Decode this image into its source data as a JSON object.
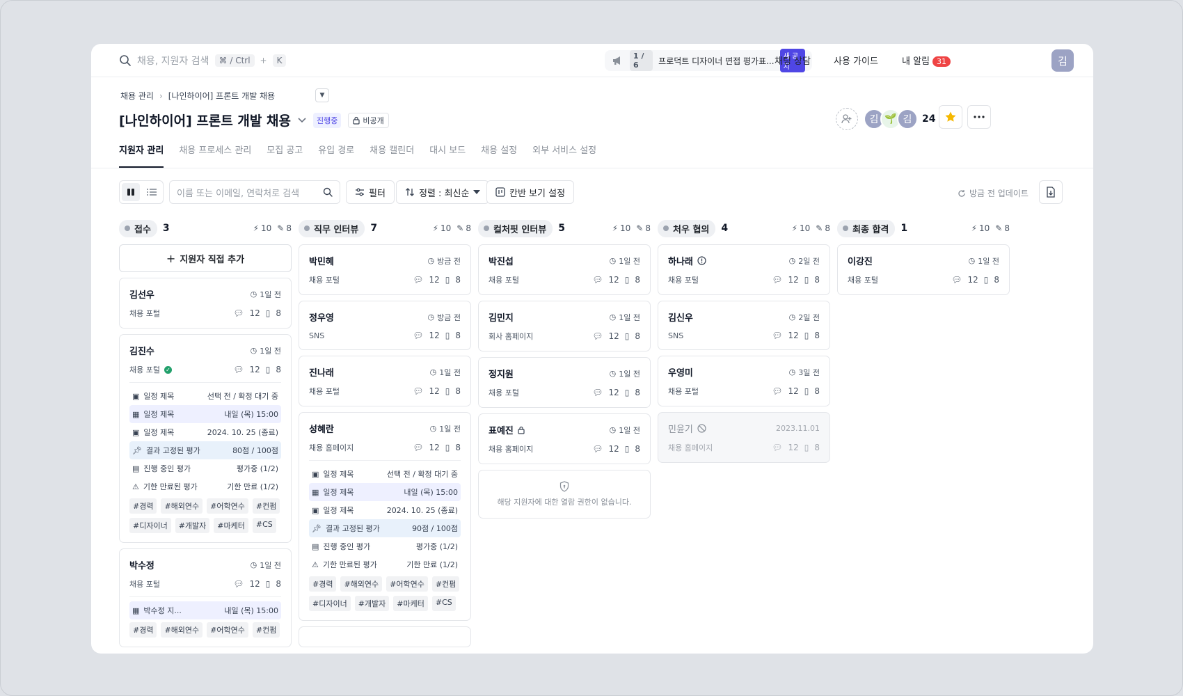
{
  "topbar": {
    "search_placeholder": "채용, 지원자 검색",
    "shortcut_key1": "⌘ / Ctrl",
    "shortcut_plus": "+",
    "shortcut_key2": "K",
    "notice_count": "1 / 6",
    "notice_text": "프로덕트 디자이너 면접 평가표...",
    "notice_badge": "새 공지",
    "links": [
      "채팅 상담",
      "사용 가이드"
    ],
    "alerts_label": "내 알림",
    "alerts_count": "31",
    "user_initial": "김"
  },
  "header": {
    "breadcrumb_root": "채용 관리",
    "breadcrumb_current": "[나인하이어] 프론트 개발 채용",
    "title": "[나인하이어] 프론트 개발 채용",
    "status": "진행중",
    "visibility": "비공개",
    "members": [
      "김",
      "🌱",
      "김"
    ],
    "member_count": "24"
  },
  "tabs": [
    "지원자 관리",
    "채용 프로세스 관리",
    "모집 공고",
    "유입 경로",
    "채용 캘린더",
    "대시 보드",
    "채용 설정",
    "외부 서비스 설정"
  ],
  "toolbar": {
    "search_placeholder": "이름 또는 이메일, 연락처로 검색",
    "filter_label": "필터",
    "sort_label": "정렬 : 최신순",
    "kanban_settings_label": "칸반 보기 설정",
    "refresh_label": "방금 전 업데이트"
  },
  "columns": [
    {
      "name": "접수",
      "count": "3",
      "m1": "10",
      "m2": "8",
      "add_label": "지원자 직접 추가",
      "cards": [
        {
          "name": "김선우",
          "time": "1일 전",
          "source": "채용 포털",
          "s1": "12",
          "s2": "8"
        },
        {
          "name": "김진수",
          "time": "1일 전",
          "source": "채용 포털",
          "s1": "12",
          "s2": "8",
          "details": [
            {
              "label": "일정 제목",
              "value": "선택 전 / 확정 대기 중"
            },
            {
              "label": "일정 제목",
              "value": "내일 (목) 15:00"
            },
            {
              "label": "일정 제목",
              "value": "2024. 10. 25 (종료)"
            },
            {
              "label": "결과 고정된 평가",
              "value": "80점 / 100점"
            },
            {
              "label": "진행 중인 평가",
              "value": "평가중 (1/2)"
            },
            {
              "label": "기한 만료된 평가",
              "value": "기한 만료 (1/2)"
            }
          ],
          "tags": [
            "#경력",
            "#해외연수",
            "#어학연수",
            "#컨펌",
            "#디자이너",
            "#개발자",
            "#마케터",
            "#CS"
          ]
        },
        {
          "name": "박수정",
          "time": "1일 전",
          "source": "채용 포털",
          "s1": "12",
          "s2": "8",
          "details": [
            {
              "label": "박수정 지...",
              "value": "내일 (목) 15:00"
            }
          ],
          "tags": [
            "#경력",
            "#해외연수",
            "#어학연수",
            "#컨펌"
          ]
        }
      ]
    },
    {
      "name": "직무 인터뷰",
      "count": "7",
      "m1": "10",
      "m2": "8",
      "cards": [
        {
          "name": "박민혜",
          "time": "방금 전",
          "source": "채용 포털",
          "s1": "12",
          "s2": "8"
        },
        {
          "name": "정우영",
          "time": "방금 전",
          "source": "SNS",
          "s1": "12",
          "s2": "8"
        },
        {
          "name": "진나래",
          "time": "1일 전",
          "source": "채용 포털",
          "s1": "12",
          "s2": "8"
        },
        {
          "name": "성혜란",
          "time": "1일 전",
          "source": "채용 홈페이지",
          "s1": "12",
          "s2": "8",
          "details": [
            {
              "label": "일정 제목",
              "value": "선택 전 / 확정 대기 중"
            },
            {
              "label": "일정 제목",
              "value": "내일 (목) 15:00"
            },
            {
              "label": "일정 제목",
              "value": "2024. 10. 25 (종료)"
            },
            {
              "label": "결과 고정된 평가",
              "value": "90점 / 100점"
            },
            {
              "label": "진행 중인 평가",
              "value": "평가중 (1/2)"
            },
            {
              "label": "기한 만료된 평가",
              "value": "기한 만료 (1/2)"
            }
          ],
          "tags": [
            "#경력",
            "#해외연수",
            "#어학연수",
            "#컨펌",
            "#디자이너",
            "#개발자",
            "#마케터",
            "#CS"
          ]
        }
      ]
    },
    {
      "name": "컬처핏 인터뷰",
      "count": "5",
      "m1": "10",
      "m2": "8",
      "cards": [
        {
          "name": "박진섭",
          "time": "1일 전",
          "source": "채용 포털",
          "s1": "12",
          "s2": "8"
        },
        {
          "name": "김민지",
          "time": "1일 전",
          "source": "회사 홈페이지",
          "s1": "12",
          "s2": "8"
        },
        {
          "name": "정지원",
          "time": "1일 전",
          "source": "채용 포털",
          "s1": "12",
          "s2": "8"
        },
        {
          "name": "표예진",
          "time": "1일 전",
          "source": "채용 홈페이지",
          "s1": "12",
          "s2": "8"
        }
      ],
      "no_permission": "해당 지원자에 대한 열람 권한이 없습니다."
    },
    {
      "name": "처우 협의",
      "count": "4",
      "m1": "10",
      "m2": "8",
      "cards": [
        {
          "name": "하나래",
          "time": "2일 전",
          "source": "채용 포털",
          "s1": "12",
          "s2": "8"
        },
        {
          "name": "김신우",
          "time": "2일 전",
          "source": "SNS",
          "s1": "12",
          "s2": "8"
        },
        {
          "name": "우영미",
          "time": "3일 전",
          "source": "채용 포털",
          "s1": "12",
          "s2": "8"
        },
        {
          "name": "민윤기",
          "time": "2023.11.01",
          "source": "채용 홈페이지",
          "s1": "12",
          "s2": "8"
        }
      ]
    },
    {
      "name": "최종 합격",
      "count": "1",
      "m1": "10",
      "m2": "8",
      "cards": [
        {
          "name": "이강진",
          "time": "1일 전",
          "source": "채용 포털",
          "s1": "12",
          "s2": "8"
        }
      ]
    }
  ]
}
